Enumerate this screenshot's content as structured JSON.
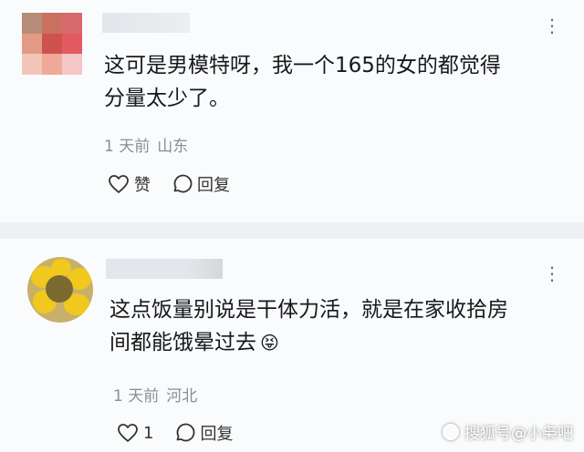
{
  "comments": [
    {
      "text_lines": [
        "这可是男模特呀，我一个165的女的都觉得",
        "分量太少了。"
      ],
      "time": "1 天前",
      "location": "山东",
      "like_label": "赞",
      "reply_label": "回复"
    },
    {
      "text_lines": [
        "这点饭量别说是干体力活，就是在家收拾房",
        "间都能饿晕过去"
      ],
      "emoji": "😝",
      "time": "1 天前",
      "location": "河北",
      "like_count": "1",
      "reply_label": "回复"
    }
  ],
  "more_icon": "⋮",
  "watermark": {
    "text": "搜狐号@小枭吧"
  },
  "icons": [
    "more-icon",
    "heart-icon",
    "comment-bubble-icon",
    "sohu-logo-icon"
  ]
}
